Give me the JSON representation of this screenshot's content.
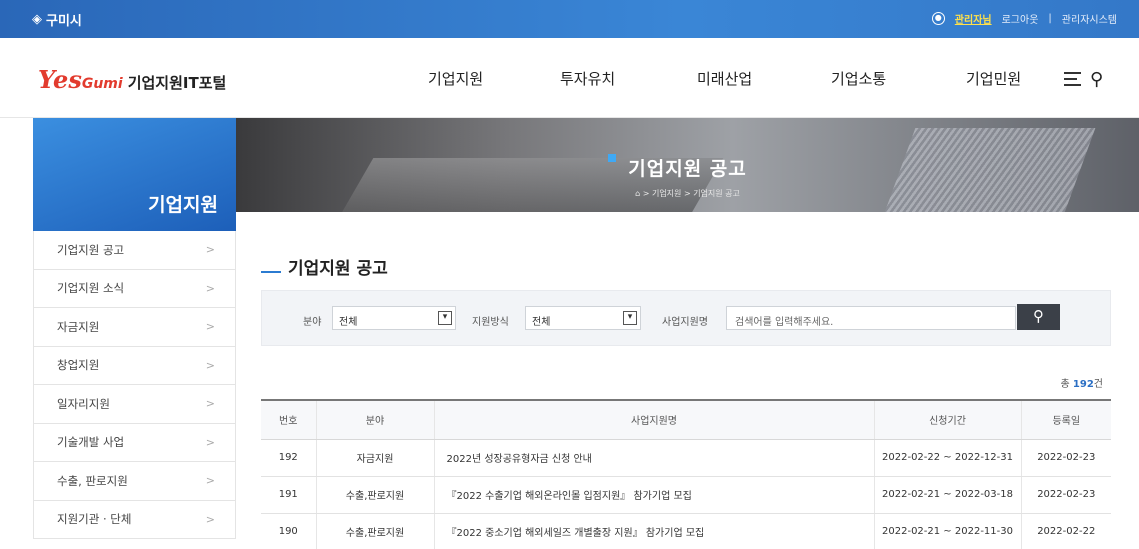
{
  "topbar": {
    "city_name": "구미시",
    "admin": "관리자님",
    "logout": "로그아웃",
    "separator": "|",
    "admin_system": "관리자시스템"
  },
  "header": {
    "logo_yes": "Yes",
    "logo_gumi": "Gumi",
    "logo_portal": "기업지원IT포털",
    "nav": [
      "기업지원",
      "투자유치",
      "미래산업",
      "기업소통",
      "기업민원"
    ]
  },
  "hero": {
    "title": "기업지원 공고",
    "breadcrumb": "> 기업지원 > 기업지원 공고"
  },
  "sidebar": {
    "title": "기업지원",
    "items": [
      {
        "label": "기업지원 공고"
      },
      {
        "label": "기업지원 소식"
      },
      {
        "label": "자금지원"
      },
      {
        "label": "창업지원"
      },
      {
        "label": "일자리지원"
      },
      {
        "label": "기술개발 사업"
      },
      {
        "label": "수출, 판로지원"
      },
      {
        "label": "지원기관 · 단체"
      }
    ]
  },
  "main": {
    "title": "기업지원 공고",
    "search": {
      "field_label": "분야",
      "field_value": "전체",
      "type_label": "지원방식",
      "type_value": "전체",
      "keyword_label": "사업지원명",
      "keyword_placeholder": "검색어를 입력해주세요."
    },
    "total_prefix": "총",
    "total_count": "192",
    "total_suffix": "건",
    "columns": [
      "번호",
      "분야",
      "사업지원명",
      "신청기간",
      "등록일"
    ],
    "rows": [
      {
        "no": "192",
        "field": "자금지원",
        "title": "2022년 성장공유형자금 신청 안내",
        "period": "2022-02-22 ~ 2022-12-31",
        "date": "2022-02-23"
      },
      {
        "no": "191",
        "field": "수출,판로지원",
        "title": "『2022 수출기업 해외온라인몰 입점지원』 참가기업 모집",
        "period": "2022-02-21 ~ 2022-03-18",
        "date": "2022-02-23"
      },
      {
        "no": "190",
        "field": "수출,판로지원",
        "title": "『2022 중소기업 해외세일즈 개별출장 지원』 참가기업 모집",
        "period": "2022-02-21 ~ 2022-11-30",
        "date": "2022-02-22"
      }
    ]
  },
  "icons": {
    "city_logo": "city-mark-icon",
    "user": "user-icon",
    "menu": "hamburger-menu-icon",
    "search": "search-icon",
    "home": "home-icon",
    "dropdown": "chevron-down-icon",
    "arrow": "chevron-right-icon"
  },
  "colors": {
    "topbar_blue": "#2a67b8",
    "sidebar_blue": "#1d5fb9",
    "logo_red": "#e23b2e",
    "accent_blue": "#2b7bd1"
  }
}
